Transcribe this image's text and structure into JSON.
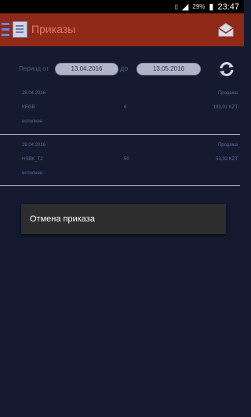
{
  "status_bar": {
    "battery": "29%",
    "time": "23:47",
    "icons": [
      "sim-icon",
      "signal-icon",
      "battery-icon"
    ]
  },
  "app_bar": {
    "title": "Приказы",
    "menu_icon": "hamburger-icon",
    "app_icon": "document-icon",
    "action_icon": "mail-icon"
  },
  "filter": {
    "period_label": "Период от",
    "date_from": "13.04.2016",
    "separator": "до",
    "date_to": "13.05.2016",
    "refresh_icon": "refresh-icon"
  },
  "orders": [
    {
      "date": "28.04.2016",
      "type": "Продажа",
      "instrument": "KEGB",
      "quantity": "6",
      "price": "193,01 KZT",
      "status": "исполнен"
    },
    {
      "date": "28.04.2016",
      "type": "Продажа",
      "instrument": "HSBK_T2",
      "quantity": "50",
      "price": "53,33 KZT",
      "status": "исполнен"
    }
  ],
  "toast": {
    "text": "Отмена приказа"
  },
  "colors": {
    "app_bar": "#8e2a17",
    "background": "#141b30",
    "title": "#e27a64",
    "toast": "#2d2d2d"
  }
}
